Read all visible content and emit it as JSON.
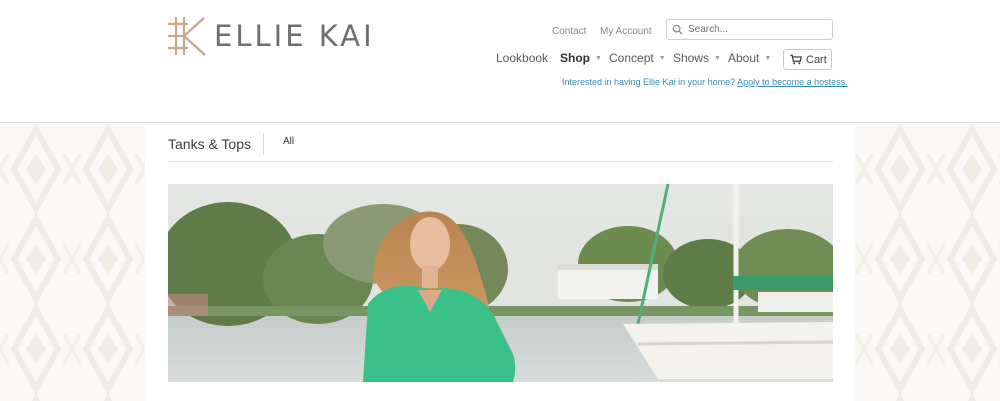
{
  "brand": {
    "name": "ELLIE KAI"
  },
  "header": {
    "util_links": [
      "Contact",
      "My Account"
    ],
    "search": {
      "placeholder": "Search..."
    },
    "nav": {
      "lookbook": "Lookbook",
      "shop": "Shop",
      "concept": "Concept",
      "shows": "Shows",
      "about": "About"
    },
    "cart_label": "Cart",
    "hostess_text": "Interested in having Ellie Kai in your home?",
    "hostess_link": "Apply to become a hostess."
  },
  "breadcrumb": {
    "title": "Tanks & Tops",
    "filter": "All"
  },
  "colors": {
    "accent_link": "#3a8fb7",
    "logo_tan": "#c4a98a",
    "logo_text": "#6d6e71",
    "blouse_green": "#3cc08a"
  }
}
